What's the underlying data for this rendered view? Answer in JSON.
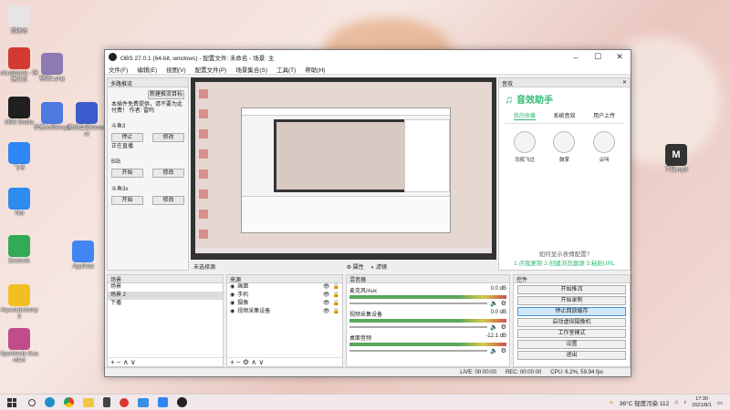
{
  "desktop": {
    "icons_left": [
      {
        "label": "回收站",
        "icon": "recycle-bin-icon",
        "color": "#e5e5e5"
      },
      {
        "label": "cloudmusic - 快捷方式",
        "icon": "netease-music-icon",
        "color": "#d33a31"
      },
      {
        "label": "OBS Studio",
        "icon": "obs-icon",
        "color": "#1f1f1f"
      },
      {
        "label": "飞书",
        "icon": "feishu-icon",
        "color": "#2f86f6"
      },
      {
        "label": "TIM",
        "icon": "tim-icon",
        "color": "#2d8cf0"
      },
      {
        "label": "Ecutools",
        "icon": "ecutools-icon",
        "color": "#33aa55"
      },
      {
        "label": "4kyoutubetomp3",
        "icon": "yt-mp3-icon",
        "color": "#f0c020"
      },
      {
        "label": "Sparkleofy Guardian",
        "icon": "sparkle-icon",
        "color": "#c04d8a"
      },
      {
        "label": "tianhejpg",
        "icon": "image-file-icon",
        "color": "#9a7fb5"
      }
    ],
    "icons_mid": [
      {
        "label": "壁纸1.png",
        "icon": "image-thumb-icon",
        "color": "#8c7bb0"
      },
      {
        "label": "伴奏大师Kmp3",
        "icon": "mp3-file-icon",
        "color": "#4c7ae0"
      },
      {
        "label": "腾讯会议Wemeet",
        "icon": "wemeet-icon",
        "color": "#3a5ccc"
      },
      {
        "label": "AppData",
        "icon": "app-icon",
        "color": "#4285f4"
      }
    ],
    "icon_right": {
      "label": "下载.mp3",
      "icon": "audio-file-icon",
      "color": "#333333"
    }
  },
  "window": {
    "title": "OBS 27.0.1 (64-bit, windows) - 配置文件: 未命名 - 场景: 主",
    "menu": [
      "文件(F)",
      "编辑(E)",
      "视图(V)",
      "配置文件(P)",
      "场景集合(S)",
      "工具(T)",
      "帮助(H)"
    ]
  },
  "left_dock": {
    "title": "多路推流",
    "new_button": "新建推流目标",
    "hint": "本插件免费提供，请不要为此付费！ 作者: 雷鸣",
    "targets": [
      {
        "name": "斗鱼3",
        "btn1": "停止",
        "btn2": "修改",
        "status": "正在直播"
      },
      {
        "name": "B站",
        "btn1": "开始",
        "btn2": "修改",
        "status": ""
      },
      {
        "name": "斗鱼3x",
        "btn1": "开始",
        "btn2": "修改",
        "status": ""
      }
    ]
  },
  "assistant": {
    "panel_title": "音效",
    "title": "音效助手",
    "tabs": [
      "我的收藏",
      "系统音效",
      "用户上传"
    ],
    "effects": [
      "乌鸦飞过",
      "鼓掌",
      "尖叫"
    ],
    "help_title": "如何显示表情配置?",
    "help_steps": "1.点我复制 2.创建浏览器源 3.粘贴URL"
  },
  "preview_bar": {
    "label": "未选择源",
    "props": "属性",
    "filters": "滤镜"
  },
  "scenes": {
    "title": "场景",
    "items": [
      "场景",
      "场景 2",
      "下播"
    ],
    "selected": 1
  },
  "sources": {
    "title": "来源",
    "items": [
      "画面",
      "手机",
      "摄像",
      "视频采集设备"
    ]
  },
  "mixer": {
    "title": "混音器",
    "channels": [
      {
        "name": "麦克风/Aux",
        "db": "0.0 dB"
      },
      {
        "name": "视频采集设备",
        "db": "0.0 dB"
      },
      {
        "name": "桌面音频",
        "db": "-12.1 dB"
      }
    ]
  },
  "controls": {
    "title": "控件",
    "buttons": [
      "开始推流",
      "开始录制",
      "停止回放缓存",
      "启动虚拟摄像机",
      "工作室模式",
      "设置",
      "退出"
    ],
    "active_index": 2
  },
  "status": {
    "live": "LIVE: 00:00:00",
    "rec": "REC: 00:00:00",
    "cpu": "CPU: 6.2%, 59.94 fps"
  },
  "taskbar": {
    "weather": "36°C 轻度污染 112",
    "time": "17:30",
    "date": "2021/8/1"
  }
}
